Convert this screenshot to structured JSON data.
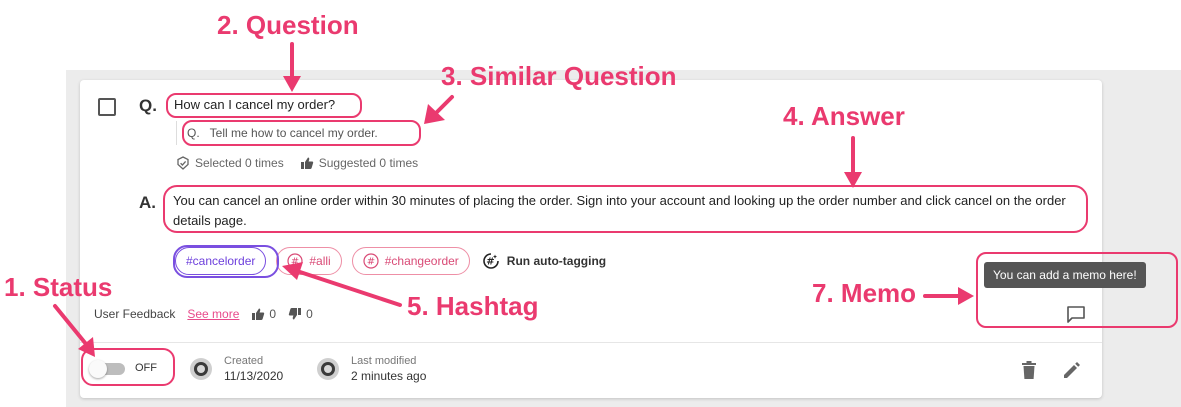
{
  "card": {
    "question_prefix": "Q.",
    "question": "How can I cancel my order?",
    "similar_prefix": "Q.",
    "similar_question": "Tell me how to cancel my order.",
    "selected_stat": "Selected 0 times",
    "suggested_stat": "Suggested 0 times",
    "answer_prefix": "A.",
    "answer": "You can cancel an online order within 30 minutes of placing the order. Sign into your account and looking up the order number and click cancel on the order details page.",
    "hashtags": [
      "#cancelorder",
      "#alli",
      "#changeorder"
    ],
    "auto_tagging_label": "Run auto-tagging",
    "feedback_label": "User Feedback",
    "see_more": "See more",
    "thumbs_up_count": "0",
    "thumbs_down_count": "0",
    "memo_tooltip": "You can add a memo here!",
    "status_label": "OFF",
    "created_label": "Created",
    "created_value": "11/13/2020",
    "modified_label": "Last modified",
    "modified_value": "2 minutes ago"
  },
  "annotations": {
    "status": "1. Status",
    "question": "2. Question",
    "similar_question": "3. Similar Question",
    "answer": "4. Answer",
    "hashtag": "5. Hashtag",
    "memo": "7. Memo"
  },
  "colors": {
    "annotation": "#ea3a6f",
    "hashtag_active": "#6d3fdc",
    "hashtag": "#d94a76",
    "tooltip_bg": "#555555"
  }
}
